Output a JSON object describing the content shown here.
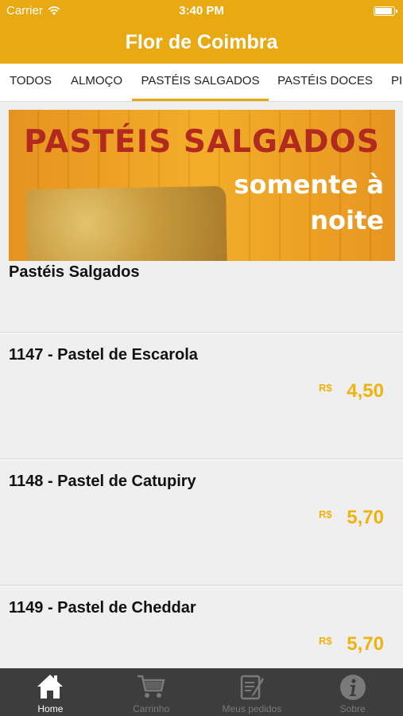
{
  "status_bar": {
    "carrier": "Carrier",
    "time": "3:40 PM"
  },
  "nav": {
    "title": "Flor de Coimbra"
  },
  "tabs": [
    {
      "label": "TODOS"
    },
    {
      "label": "ALMOÇO"
    },
    {
      "label": "PASTÉIS SALGADOS",
      "active": true
    },
    {
      "label": "PASTÉIS DOCES"
    },
    {
      "label": "PI"
    }
  ],
  "banner": {
    "headline": "PASTÉIS SALGADOS",
    "line1": "somente à",
    "line2": "noite"
  },
  "category": {
    "title": "Pastéis Salgados"
  },
  "items": [
    {
      "name": "1147 - Pastel de Escarola",
      "currency": "R$",
      "price": "4,50"
    },
    {
      "name": "1148 - Pastel de Catupiry",
      "currency": "R$",
      "price": "5,70"
    },
    {
      "name": "1149 - Pastel de Cheddar",
      "currency": "R$",
      "price": "5,70"
    }
  ],
  "tabbar": [
    {
      "label": "Home",
      "icon": "home-icon",
      "active": true
    },
    {
      "label": "Carrinho",
      "icon": "cart-icon"
    },
    {
      "label": "Meus pedidos",
      "icon": "orders-icon"
    },
    {
      "label": "Sobre",
      "icon": "info-icon"
    }
  ],
  "colors": {
    "accent": "#e8a912",
    "price": "#f0b20f",
    "tabbar_bg": "#3d3d3d"
  }
}
